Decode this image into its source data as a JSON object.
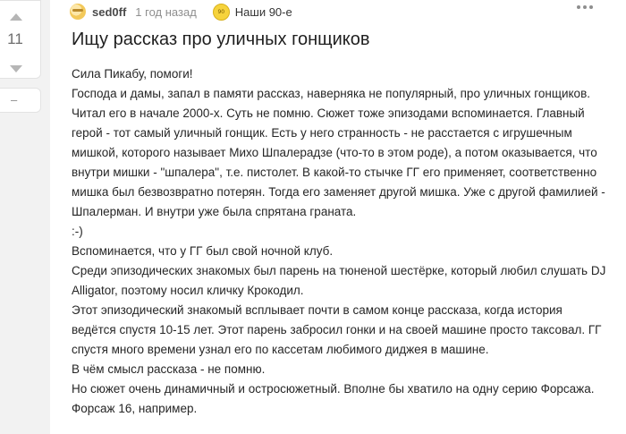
{
  "vote": {
    "count": "11",
    "minus_label": "–"
  },
  "post": {
    "author": "sed0ff",
    "time": "1 год назад",
    "community": "Наши 90-е",
    "community_icon_text": "90",
    "title": "Ищу рассказ про уличных гонщиков",
    "lines": [
      "Сила Пикабу, помоги!",
      "Господа и дамы, запал в памяти рассказ, наверняка не популярный, про уличных гонщиков.",
      "Читал его в начале 2000-х. Суть не помню. Сюжет тоже эпизодами вспоминается. Главный",
      "герой - тот самый уличный гонщик. Есть у него странность - не расстается с игрушечным",
      "мишкой, которого называет Михо Шпалерадзе (что-то в  этом роде), а потом оказывается, что",
      "внутри мишки - \"шпалера\", т.е. пистолет. В какой-то стычке ГГ его применяет, соответственно",
      "мишка был безвозвратно потерян. Тогда его заменяет другой мишка. Уже с другой фамилией -",
      "Шпалерман. И внутри уже была спрятана граната.",
      ":-)",
      "Вспоминается, что у ГГ был свой ночной клуб.",
      "Среди эпизодических знакомых был парень на тюненой шестёрке, который любил слушать DJ",
      "Alligator, поэтому носил кличку Крокодил.",
      "Этот эпизодический знакомый всплывает почти в самом конце рассказа, когда история",
      "ведётся спустя 10-15 лет. Этот парень забросил гонки и на своей машине просто таксовал. ГГ",
      "спустя много времени узнал его по кассетам любимого диджея в машине.",
      "В чём смысл рассказа - не помню.",
      "Но сюжет очень динамичный и остросюжетный. Вполне бы хватило на одну серию Форсажа.",
      "Форсаж 16, например."
    ]
  }
}
